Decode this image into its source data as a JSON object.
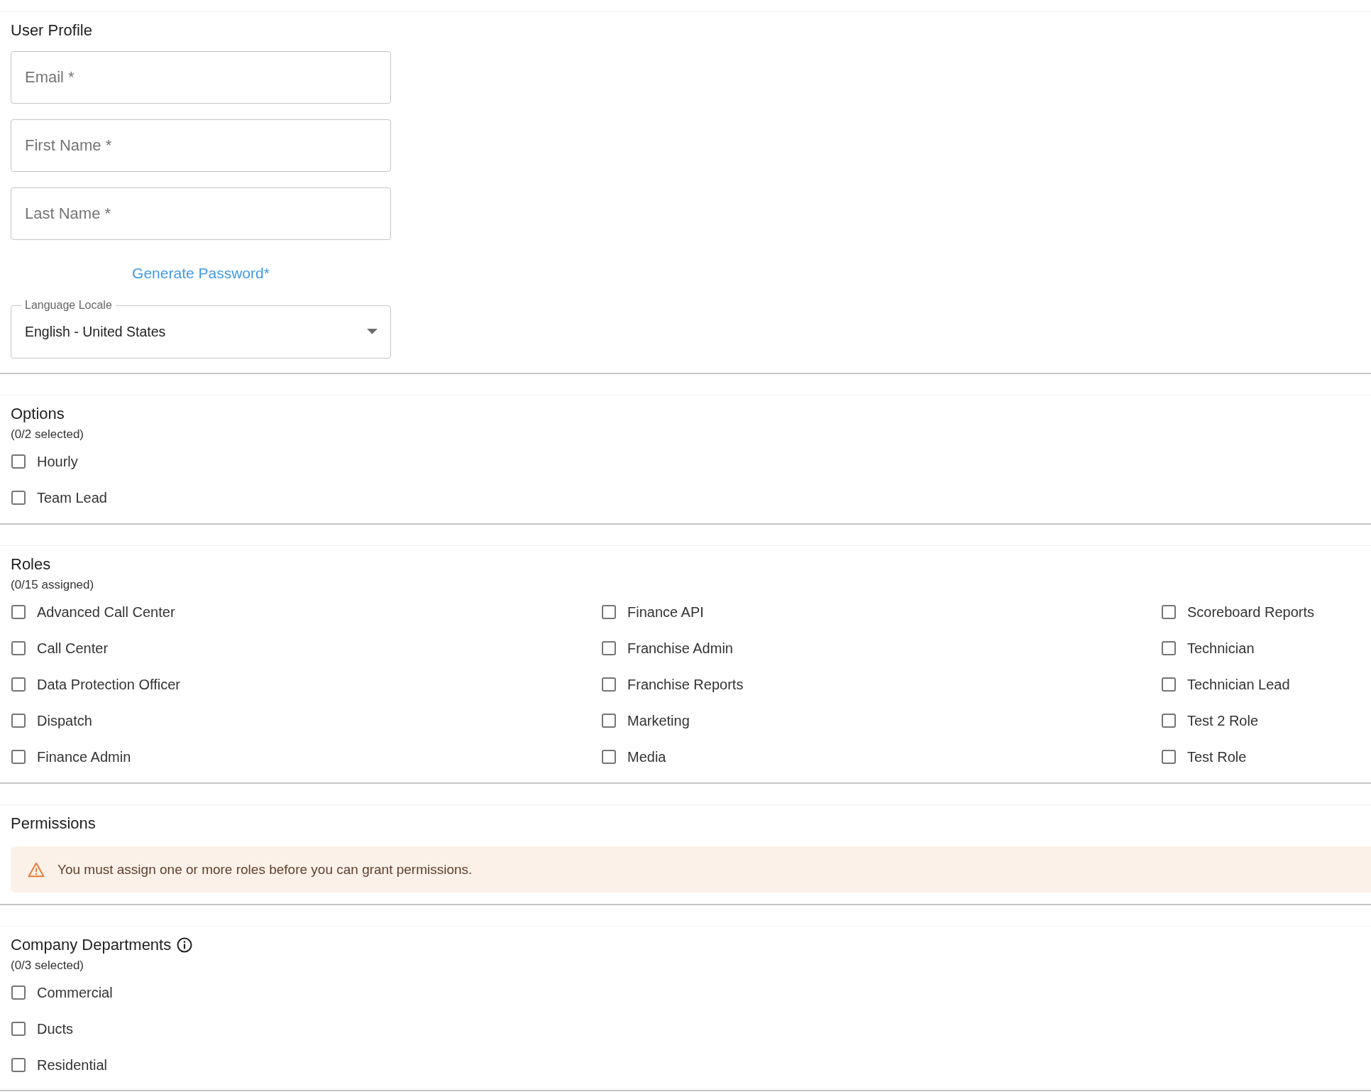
{
  "user_profile": {
    "title": "User Profile",
    "fields": [
      {
        "placeholder": "Email *"
      },
      {
        "placeholder": "First Name *"
      },
      {
        "placeholder": "Last Name *"
      }
    ],
    "generate_password": "Generate Password*",
    "language_locale": {
      "label": "Language Locale",
      "value": "English - United States"
    }
  },
  "options": {
    "title": "Options",
    "count": "(0/2 selected)",
    "items": [
      {
        "label": "Hourly",
        "checked": false
      },
      {
        "label": "Team Lead",
        "checked": false
      }
    ]
  },
  "roles": {
    "title": "Roles",
    "count": "(0/15 assigned)",
    "items": [
      {
        "label": "Advanced Call Center",
        "checked": false
      },
      {
        "label": "Call Center",
        "checked": false
      },
      {
        "label": "Data Protection Officer",
        "checked": false
      },
      {
        "label": "Dispatch",
        "checked": false
      },
      {
        "label": "Finance Admin",
        "checked": false
      },
      {
        "label": "Finance API",
        "checked": false
      },
      {
        "label": "Franchise Admin",
        "checked": false
      },
      {
        "label": "Franchise Reports",
        "checked": false
      },
      {
        "label": "Marketing",
        "checked": false
      },
      {
        "label": "Media",
        "checked": false
      },
      {
        "label": "Scoreboard Reports",
        "checked": false
      },
      {
        "label": "Technician",
        "checked": false
      },
      {
        "label": "Technician Lead",
        "checked": false
      },
      {
        "label": "Test 2 Role",
        "checked": false
      },
      {
        "label": "Test Role",
        "checked": false
      }
    ]
  },
  "permissions": {
    "title": "Permissions",
    "alert": "You must assign one or more roles before you can grant permissions."
  },
  "company_departments": {
    "title": "Company Departments",
    "count": "(0/3 selected)",
    "items": [
      {
        "label": "Commercial",
        "checked": false
      },
      {
        "label": "Ducts",
        "checked": false
      },
      {
        "label": "Residential",
        "checked": false
      }
    ]
  }
}
